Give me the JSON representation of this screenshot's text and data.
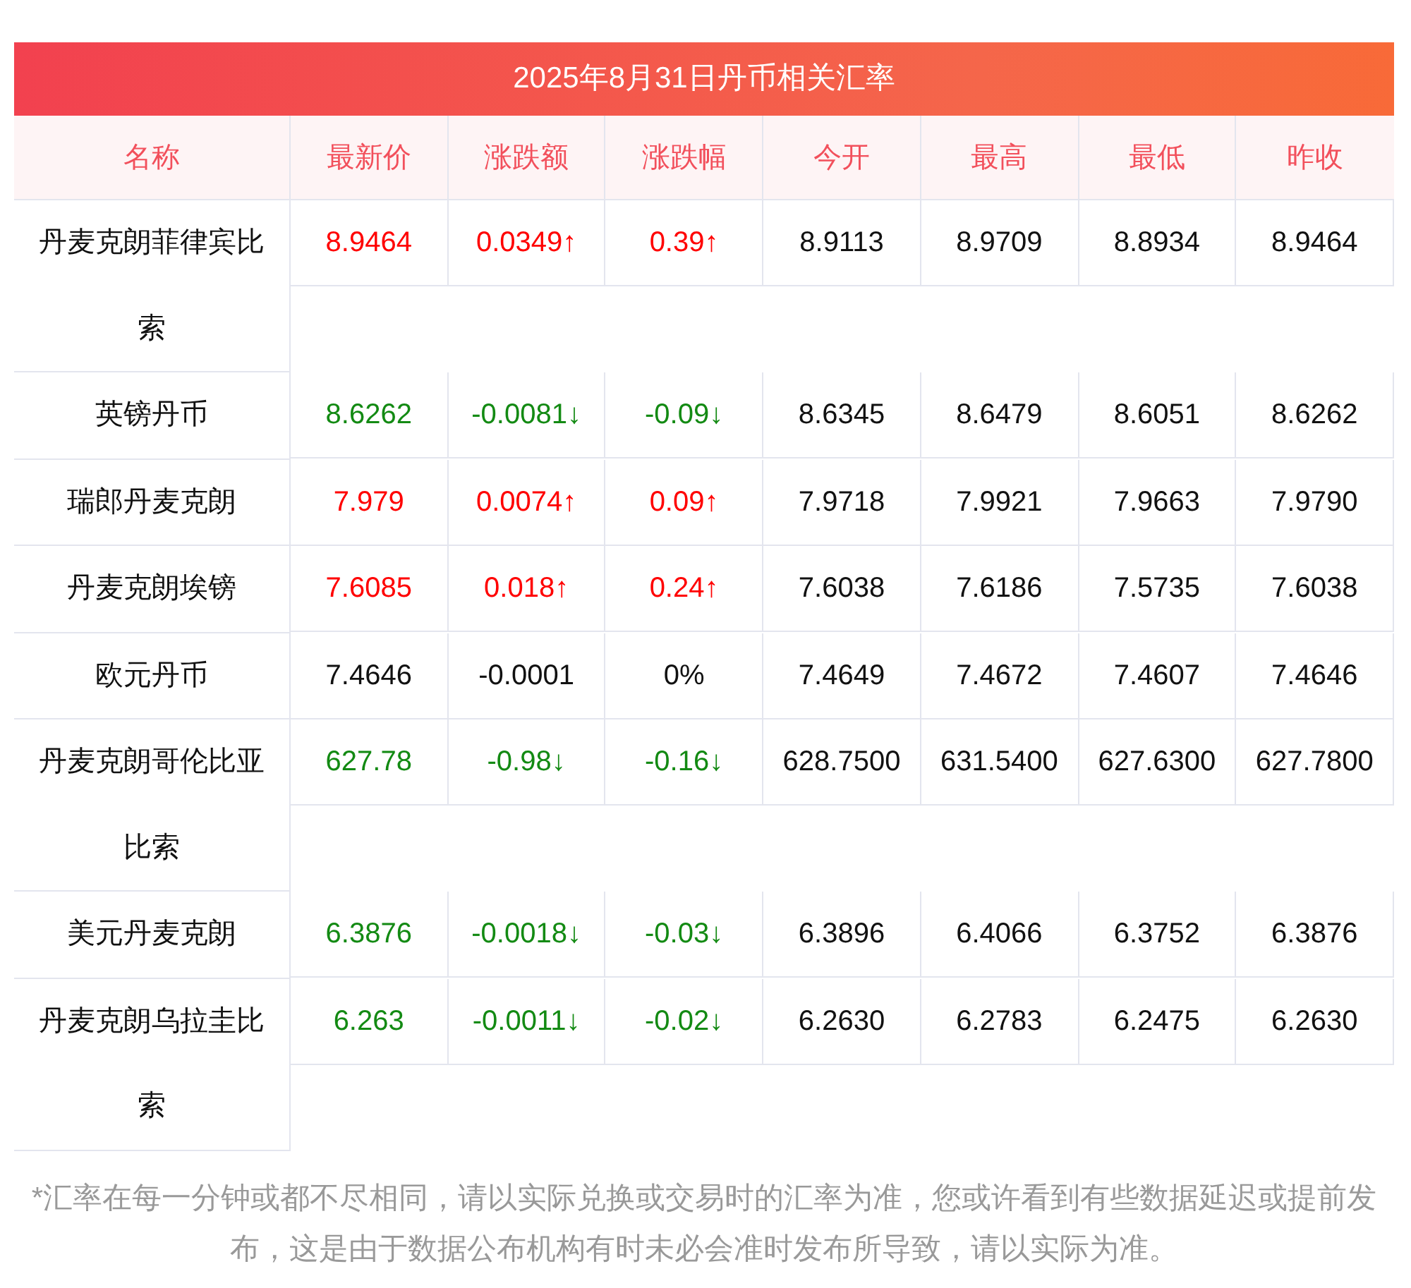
{
  "title": "2025年8月31日丹币相关汇率",
  "columns": [
    "名称",
    "最新价",
    "涨跌额",
    "涨跌幅",
    "今开",
    "最高",
    "最低",
    "昨收"
  ],
  "rows": [
    {
      "name": "丹麦克朗菲律宾比索",
      "color": "#ff0000",
      "latest": "8.9464",
      "change": "0.0349↑",
      "change_pct": "0.39↑",
      "open": "8.9113",
      "high": "8.9709",
      "low": "8.8934",
      "prev_close": "8.9464"
    },
    {
      "name": "英镑丹币",
      "color": "#138a13",
      "latest": "8.6262",
      "change": "-0.0081↓",
      "change_pct": "-0.09↓",
      "open": "8.6345",
      "high": "8.6479",
      "low": "8.6051",
      "prev_close": "8.6262"
    },
    {
      "name": "瑞郎丹麦克朗",
      "color": "#ff0000",
      "latest": "7.979",
      "change": "0.0074↑",
      "change_pct": "0.09↑",
      "open": "7.9718",
      "high": "7.9921",
      "low": "7.9663",
      "prev_close": "7.9790"
    },
    {
      "name": "丹麦克朗埃镑",
      "color": "#ff0000",
      "latest": "7.6085",
      "change": "0.018↑",
      "change_pct": "0.24↑",
      "open": "7.6038",
      "high": "7.6186",
      "low": "7.5735",
      "prev_close": "7.6038"
    },
    {
      "name": "欧元丹币",
      "color": "#111111",
      "latest": "7.4646",
      "change": "-0.0001",
      "change_pct": "0%",
      "open": "7.4649",
      "high": "7.4672",
      "low": "7.4607",
      "prev_close": "7.4646"
    },
    {
      "name": "丹麦克朗哥伦比亚比索",
      "color": "#138a13",
      "latest": "627.78",
      "change": "-0.98↓",
      "change_pct": "-0.16↓",
      "open": "628.7500",
      "high": "631.5400",
      "low": "627.6300",
      "prev_close": "627.7800"
    },
    {
      "name": "美元丹麦克朗",
      "color": "#138a13",
      "latest": "6.3876",
      "change": "-0.0018↓",
      "change_pct": "-0.03↓",
      "open": "6.3896",
      "high": "6.4066",
      "low": "6.3752",
      "prev_close": "6.3876"
    },
    {
      "name": "丹麦克朗乌拉圭比索",
      "color": "#138a13",
      "latest": "6.263",
      "change": "-0.0011↓",
      "change_pct": "-0.02↓",
      "open": "6.2630",
      "high": "6.2783",
      "low": "6.2475",
      "prev_close": "6.2630"
    }
  ],
  "note": "*汇率在每一分钟或都不尽相同，请以实际兑换或交易时的汇率为准，您或许看到有些数据延迟或提前发布，这是由于数据公布机构有时未必会准时发布所导致，请以实际为准。"
}
